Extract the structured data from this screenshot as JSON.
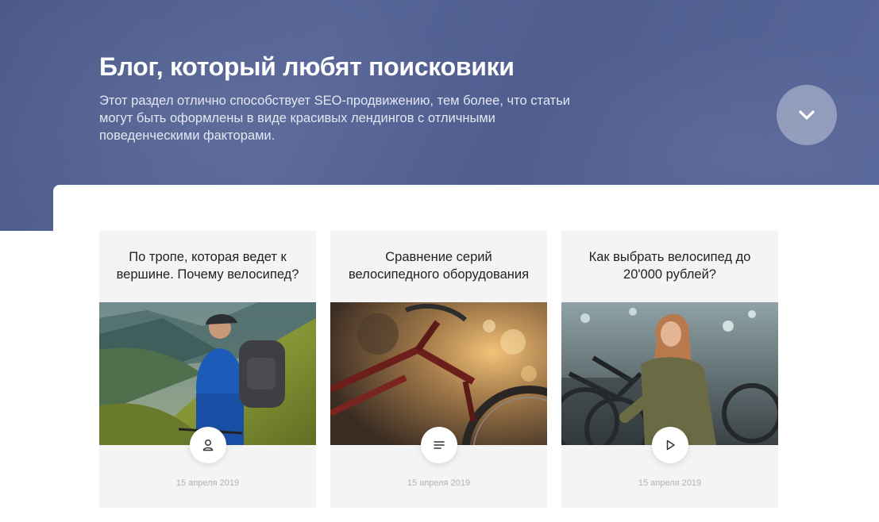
{
  "hero": {
    "title": "Блог, который любят поисковики",
    "description_lines": [
      "Этот раздел отлично способствует SEO-продвижению, тем более, что статьи",
      "могут быть оформлены в виде красивых лендингов с отличными",
      "поведенческими факторами."
    ],
    "scroll_icon": "chevron-down-icon"
  },
  "cards": [
    {
      "title_lines": [
        "По тропе, которая ведет к",
        "вершине. Почему велосипед?"
      ],
      "image": "cyclist with backpack on mountain trail",
      "icon": "user-icon",
      "date": "15 апреля 2019"
    },
    {
      "title_lines": [
        "Сравнение серий",
        "велосипедного оборудования"
      ],
      "image": "red bicycle close-up at sunset",
      "icon": "text-lines-icon",
      "date": "15 апреля 2019"
    },
    {
      "title_lines": [
        "Как выбрать велосипед до",
        "20'000 рублей?"
      ],
      "image": "woman choosing bicycle in store",
      "icon": "play-icon",
      "date": "15 апреля 2019"
    }
  ],
  "colors": {
    "hero_bg": "#4f5e8f",
    "card_bg": "#f4f4f4",
    "date_text": "#b3b3b3"
  }
}
